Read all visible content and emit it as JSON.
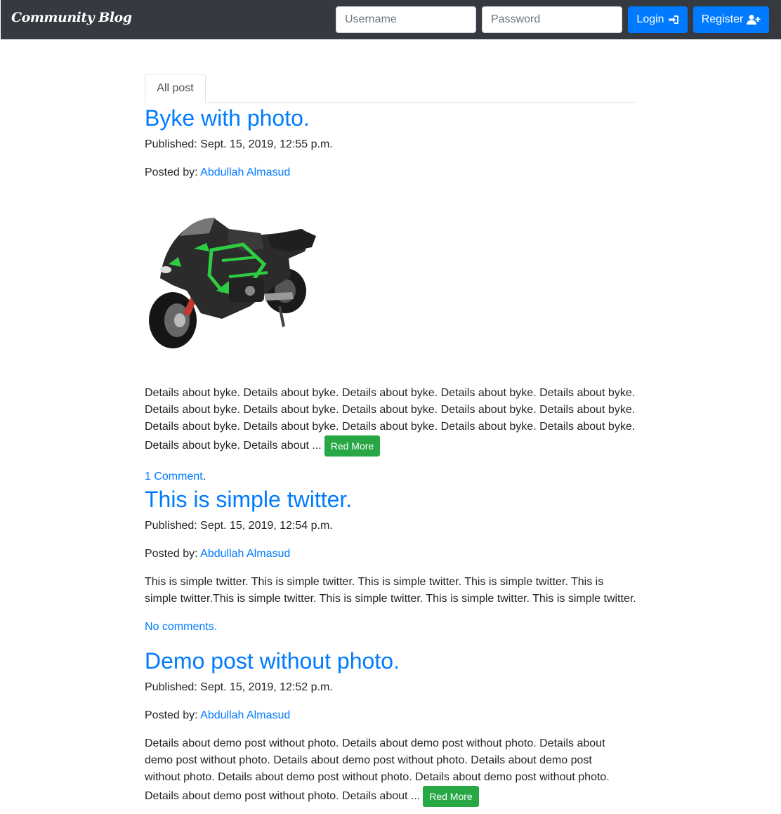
{
  "navbar": {
    "brand": "Community Blog",
    "username_placeholder": "Username",
    "password_placeholder": "Password",
    "login_label": "Login",
    "register_label": "Register"
  },
  "tabs": [
    {
      "label": "All post"
    }
  ],
  "posts": [
    {
      "title": "Byke with photo.",
      "published_label": "Published: ",
      "published": "Sept. 15, 2019, 12:55 p.m.",
      "posted_by_label": "Posted by: ",
      "author": "Abdullah Almasud",
      "body": "Details about byke. Details about byke. Details about byke. Details about byke. Details about byke. Details about byke. Details about byke. Details about byke. Details about byke. Details about byke. Details about byke. Details about byke. Details about byke. Details about byke. Details about byke. Details about byke. Details about ...",
      "read_more": "Red More",
      "comments": "1 Comment",
      "comments_suffix": "."
    },
    {
      "title": "This is simple twitter.",
      "published_label": "Published: ",
      "published": "Sept. 15, 2019, 12:54 p.m.",
      "posted_by_label": "Posted by: ",
      "author": "Abdullah Almasud",
      "body": "This is simple twitter. This is simple twitter. This is simple twitter. This is simple twitter. This is simple twitter.This is simple twitter. This is simple twitter. This is simple twitter. This is simple twitter.",
      "comments": "No comments."
    },
    {
      "title": "Demo post without photo.",
      "published_label": "Published: ",
      "published": "Sept. 15, 2019, 12:52 p.m.",
      "posted_by_label": "Posted by: ",
      "author": "Abdullah Almasud",
      "body": "Details about demo post without photo. Details about demo post without photo. Details about demo post without photo. Details about demo post without photo. Details about demo post without photo. Details about demo post without photo. Details about demo post without photo. Details about demo post without photo. Details about ...",
      "read_more": "Red More"
    }
  ],
  "colors": {
    "navbar_bg": "#343a40",
    "primary": "#007bff",
    "success": "#28a745",
    "bike_accent": "#2ecc40"
  },
  "icons": [
    "sign-in-icon",
    "user-plus-icon",
    "motorcycle-photo"
  ]
}
